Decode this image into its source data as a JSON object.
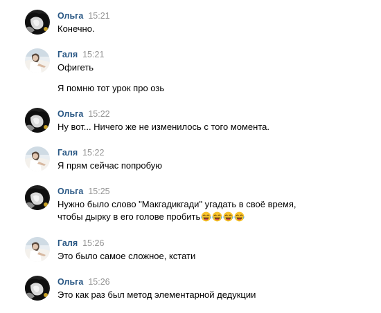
{
  "messages": [
    {
      "author": "Ольга",
      "time": "15:21",
      "avatar": "olga-avatar",
      "lines": [
        "Конечно."
      ]
    },
    {
      "author": "Галя",
      "time": "15:21",
      "avatar": "galya-avatar",
      "lines": [
        "Офигеть",
        "Я помню тот урок про озь"
      ]
    },
    {
      "author": "Ольга",
      "time": "15:22",
      "avatar": "olga-avatar",
      "lines": [
        "Ну вот... Ничего же не изменилось с того момента."
      ]
    },
    {
      "author": "Галя",
      "time": "15:22",
      "avatar": "galya-avatar",
      "lines": [
        "Я прям сейчас попробую"
      ]
    },
    {
      "author": "Ольга",
      "time": "15:25",
      "avatar": "olga-avatar",
      "lines": [
        "Нужно было слово \"Макгадикгади\" угадать в своё время,",
        "чтобы дырку в его голове пробить"
      ],
      "emoji": [
        "face-with-tears-of-joy",
        "face-with-tears-of-joy",
        "face-with-tears-of-joy",
        "face-with-tears-of-joy"
      ]
    },
    {
      "author": "Галя",
      "time": "15:26",
      "avatar": "galya-avatar",
      "lines": [
        "Это было самое сложное, кстати"
      ]
    },
    {
      "author": "Ольга",
      "time": "15:26",
      "avatar": "olga-avatar",
      "lines": [
        "Это как раз был метод элементарной дедукции"
      ]
    }
  ],
  "colors": {
    "author": "#2a5885",
    "time": "#939393",
    "text": "#000000",
    "background": "#ffffff"
  }
}
